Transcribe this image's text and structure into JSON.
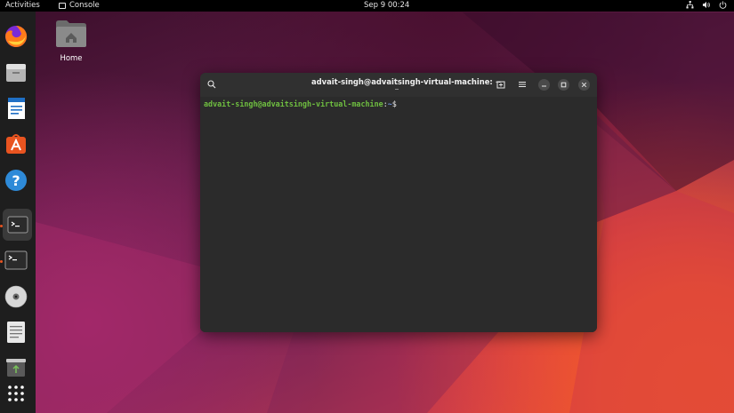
{
  "topbar": {
    "activities": "Activities",
    "app_name": "Console",
    "clock": "Sep 9  00:24",
    "tray_icons": [
      "network-icon",
      "volume-icon",
      "power-icon"
    ]
  },
  "dock": {
    "items": [
      {
        "name": "firefox-icon",
        "running": false
      },
      {
        "name": "files-icon",
        "running": false
      },
      {
        "name": "writer-icon",
        "running": false
      },
      {
        "name": "app-center-icon",
        "running": false
      },
      {
        "name": "help-icon",
        "running": false
      },
      {
        "name": "console-icon",
        "running": true,
        "active": true
      },
      {
        "name": "terminal-icon",
        "running": true
      },
      {
        "name": "disc-icon",
        "running": false
      },
      {
        "name": "text-editor-icon",
        "running": false
      },
      {
        "name": "trash-icon",
        "running": false
      },
      {
        "name": "show-apps-icon",
        "running": false
      }
    ]
  },
  "desktop": {
    "home_label": "Home"
  },
  "terminal": {
    "title": "advait-singh@advaitsingh-virtual-machine: ~",
    "prompt_user": "advait-singh@advaitsingh-virtual-machine",
    "prompt_sep": ":",
    "prompt_path": "~",
    "prompt_symbol": "$"
  },
  "colors": {
    "accent": "#e95420",
    "prompt_user": "#6fbf40",
    "prompt_path": "#6b8fd6",
    "terminal_bg": "#2b2b2b"
  }
}
